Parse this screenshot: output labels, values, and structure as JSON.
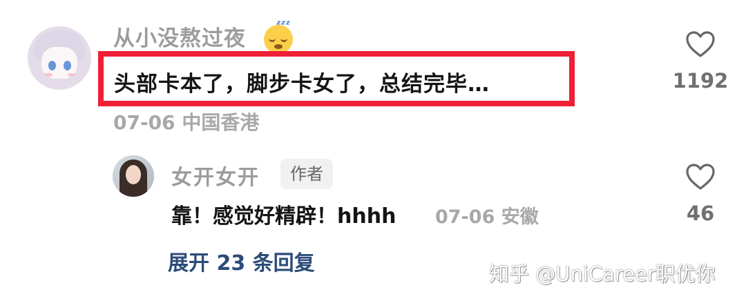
{
  "comment": {
    "username": "从小没熬过夜",
    "emoji": "sleeping-face",
    "text": "头部卡本了，脚步卡女了，总结完毕…",
    "date": "07-06",
    "location": "中国香港",
    "likes": "1192",
    "highlight_color": "#ef1f35"
  },
  "reply": {
    "username": "女开女开",
    "badge": "作者",
    "text": "靠！感觉好精辟！hhhh",
    "date": "07-06",
    "location": "安徽",
    "likes": "46"
  },
  "expand_label": "展开 23 条回复",
  "watermark": "知乎 @UniCareer职优你"
}
